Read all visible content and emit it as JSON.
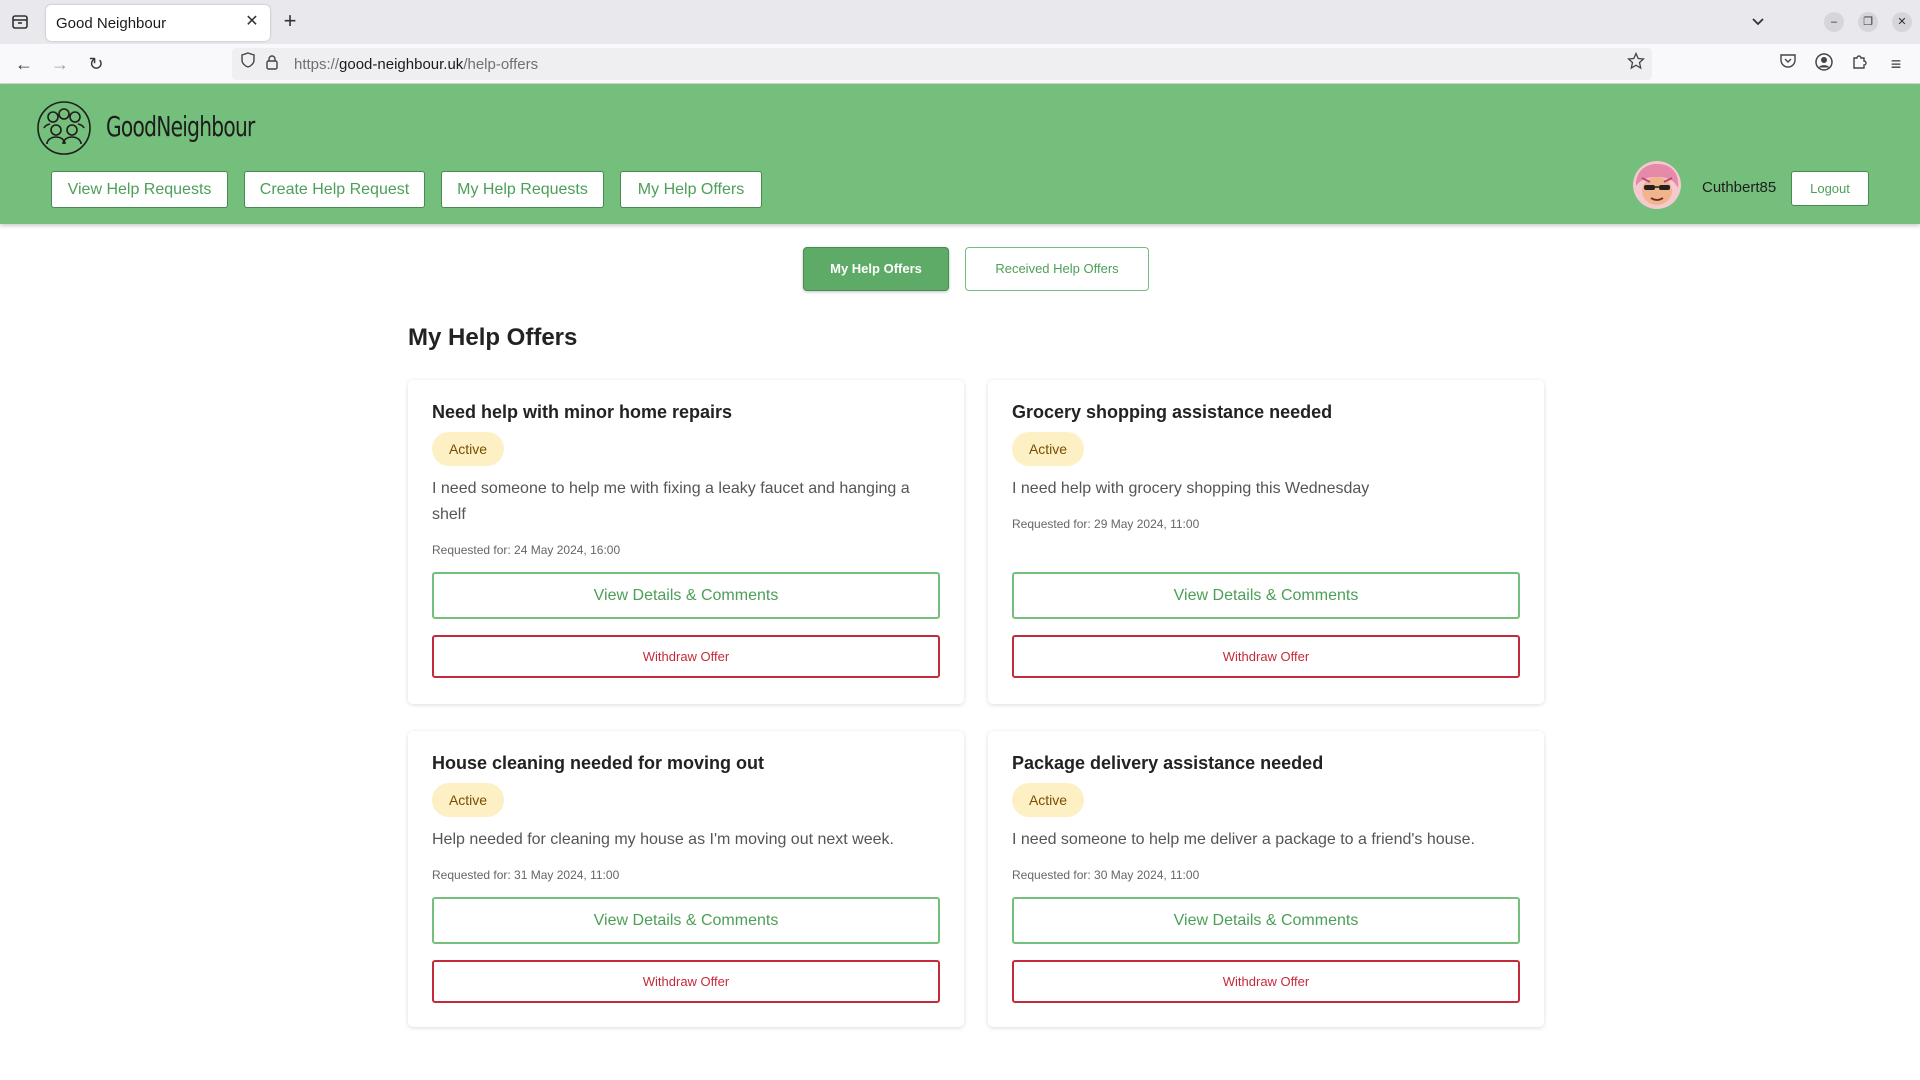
{
  "browser": {
    "tab_title": "Good Neighbour",
    "url_scheme": "https://",
    "url_host": "good-neighbour.uk",
    "url_path": "/help-offers"
  },
  "header": {
    "logo_text": "GoodNeighbour",
    "nav": [
      {
        "label": "View Help Requests"
      },
      {
        "label": "Create Help Request"
      },
      {
        "label": "My Help Requests"
      },
      {
        "label": "My Help Offers"
      }
    ],
    "username": "Cuthbert85",
    "logout_label": "Logout"
  },
  "subtabs": {
    "my_offers": "My Help Offers",
    "received_offers": "Received Help Offers"
  },
  "page_title": "My Help Offers",
  "cards": [
    {
      "title": "Need help with minor home repairs",
      "status": "Active",
      "description": "I need someone to help me with fixing a leaky faucet and hanging a shelf",
      "requested_for": "Requested for: 24 May 2024, 16:00",
      "details_label": "View Details & Comments",
      "withdraw_label": "Withdraw Offer"
    },
    {
      "title": "Grocery shopping assistance needed",
      "status": "Active",
      "description": "I need help with grocery shopping this Wednesday",
      "requested_for": "Requested for: 29 May 2024, 11:00",
      "details_label": "View Details & Comments",
      "withdraw_label": "Withdraw Offer"
    },
    {
      "title": "House cleaning needed for moving out",
      "status": "Active",
      "description": "Help needed for cleaning my house as I'm moving out next week.",
      "requested_for": "Requested for: 31 May 2024, 11:00",
      "details_label": "View Details & Comments",
      "withdraw_label": "Withdraw Offer"
    },
    {
      "title": "Package delivery assistance needed",
      "status": "Active",
      "description": "I need someone to help me deliver a package to a friend's house.",
      "requested_for": "Requested for: 30 May 2024, 11:00",
      "details_label": "View Details & Comments",
      "withdraw_label": "Withdraw Offer"
    }
  ],
  "colors": {
    "brand_green": "#74bf7c",
    "button_green": "#4c9f57",
    "danger_red": "#c42b3a",
    "badge_bg": "#fdf0c4"
  },
  "icons": {
    "tab_list": "tab-list-icon",
    "close_tab": "close-icon",
    "new_tab": "plus-icon",
    "back": "back-arrow-icon",
    "forward": "forward-arrow-icon",
    "reload": "reload-icon",
    "tracking": "shield-icon",
    "secure": "lock-icon",
    "bookmark": "star-icon",
    "pocket": "pocket-icon",
    "account": "account-icon",
    "extensions": "puzzle-icon",
    "menu": "hamburger-menu-icon"
  }
}
